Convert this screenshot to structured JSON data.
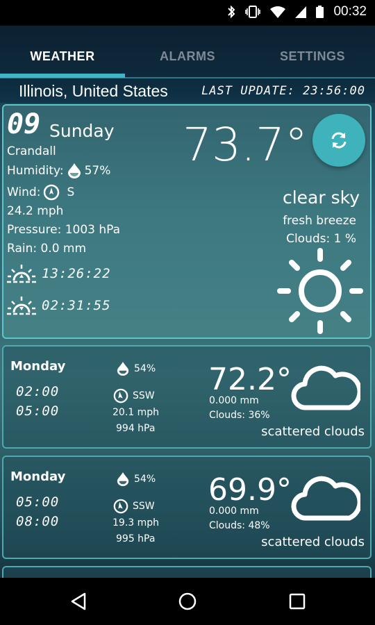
{
  "status": {
    "time": "00:32"
  },
  "tabs": [
    "WEATHER",
    "ALARMS",
    "SETTINGS"
  ],
  "location": "Illinois, United States",
  "last_update": "LAST UPDATE: 23:56:00",
  "current": {
    "day_num": "09",
    "day_name": "Sunday",
    "city": "Crandall",
    "humidity_label": "Humidity:",
    "humidity": "57%",
    "wind_label": "Wind:",
    "wind_dir": "S",
    "wind_speed": "24.2 mph",
    "pressure": "Pressure: 1003 hPa",
    "rain": "Rain: 0.0 mm",
    "sunrise": "13:26:22",
    "sunset": "02:31:55",
    "temp": "73.7°",
    "description": "clear sky",
    "wind_desc": "fresh breeze",
    "clouds": "Clouds: 1 %"
  },
  "forecast": [
    {
      "day": "Monday",
      "time_from": "02:00",
      "time_to": "05:00",
      "humidity": "54%",
      "wind_dir": "SSW",
      "wind_speed": "20.1 mph",
      "pressure": "994 hPa",
      "temp": "72.2°",
      "rain": "0.000 mm",
      "clouds": "Clouds: 36%",
      "description": "scattered clouds"
    },
    {
      "day": "Monday",
      "time_from": "05:00",
      "time_to": "08:00",
      "humidity": "54%",
      "wind_dir": "SSW",
      "wind_speed": "19.3 mph",
      "pressure": "995 hPa",
      "temp": "69.9°",
      "rain": "0.000 mm",
      "clouds": "Clouds: 48%",
      "description": "scattered clouds"
    }
  ],
  "icons": {
    "status": [
      "bluetooth-icon",
      "vibrate-icon",
      "wifi-icon",
      "signal-icon",
      "battery-icon"
    ],
    "nav": [
      "back-icon",
      "home-icon",
      "recents-icon"
    ]
  },
  "colors": {
    "accent": "#3fb5c7",
    "card_border": "#5fc5cf"
  }
}
